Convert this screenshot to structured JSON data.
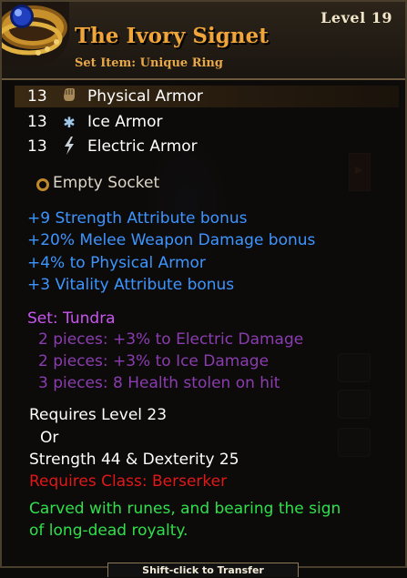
{
  "header": {
    "level": "Level 19",
    "name": "The Ivory Signet",
    "type": "Set Item: Unique Ring"
  },
  "armor": [
    {
      "value": "13",
      "label": "Physical Armor",
      "icon": "fist-icon"
    },
    {
      "value": "13",
      "label": "Ice Armor",
      "icon": "snowflake-icon"
    },
    {
      "value": "13",
      "label": "Electric Armor",
      "icon": "lightning-icon"
    }
  ],
  "socket": "Empty Socket",
  "bonuses": [
    "+9 Strength Attribute bonus",
    "+20% Melee Weapon Damage bonus",
    "+4% to Physical Armor",
    "+3 Vitality Attribute bonus"
  ],
  "set": {
    "title": "Set: Tundra",
    "pieces": [
      "2 pieces: +3% to Electric Damage",
      "2 pieces: +3% to Ice Damage",
      "3 pieces: 8 Health stolen on hit"
    ]
  },
  "requirements": {
    "level": "Requires Level 23",
    "or": "Or",
    "stats": "Strength 44 & Dexterity 25",
    "class": "Requires Class: Berserker"
  },
  "flavor": [
    "Carved with runes, and bearing the sign",
    "of long-dead royalty."
  ],
  "footer": "Shift-click to Transfer",
  "colors": {
    "name": "#f0a53a",
    "bonus": "#3d95ff",
    "set": "#c855f0",
    "class_req": "#e01818",
    "flavor": "#2fe04a"
  }
}
